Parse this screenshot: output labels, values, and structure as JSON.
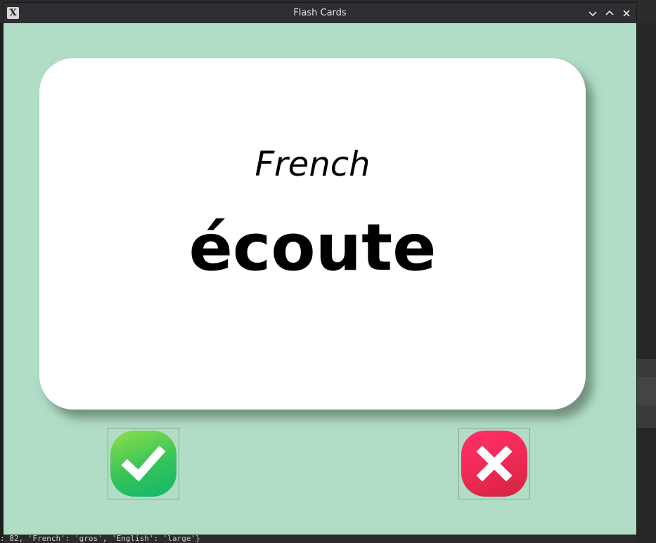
{
  "background": {
    "console_text": ": 82, 'French': 'gros', 'English': 'large'}"
  },
  "window": {
    "title": "Flash Cards",
    "app_icon_glyph": "X",
    "controls": {
      "minimize_icon": "chevron-down-icon",
      "maximize_icon": "chevron-up-icon",
      "close_icon": "close-icon"
    }
  },
  "card": {
    "language": "French",
    "word": "écoute"
  },
  "buttons": {
    "right_icon": "checkmark-icon",
    "wrong_icon": "cross-icon"
  },
  "colors": {
    "background": "#b1ddc6",
    "card": "#ffffff",
    "right_button": "#35c35a",
    "wrong_button": "#f02a55",
    "titlebar": "#2e2f33"
  }
}
